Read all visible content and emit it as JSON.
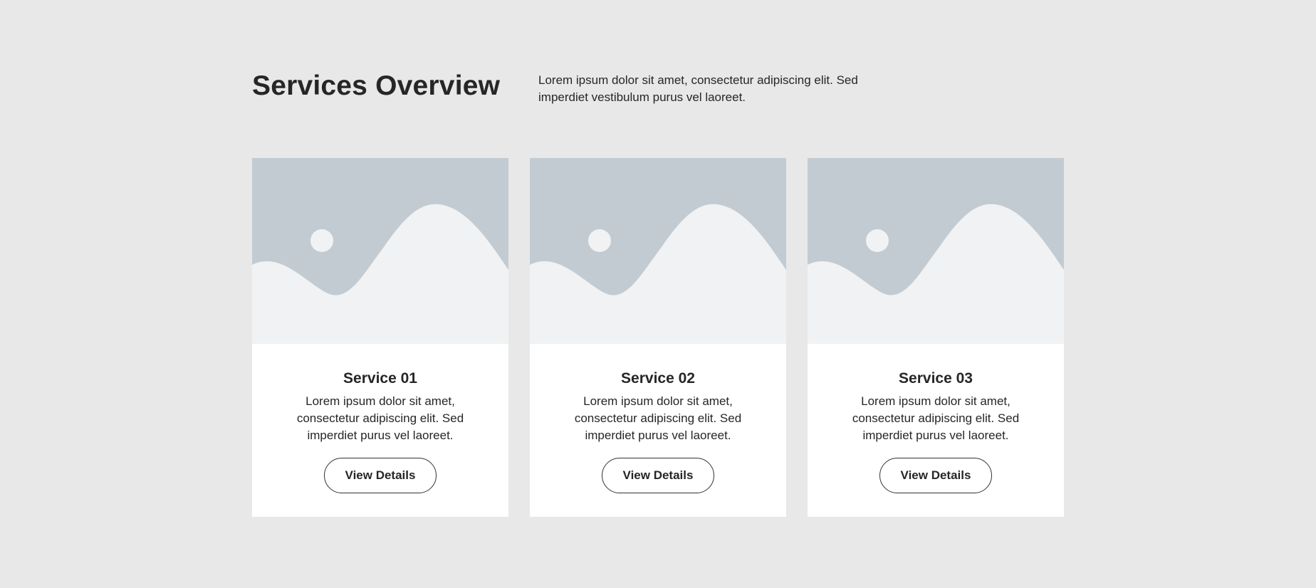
{
  "header": {
    "title": "Services Overview",
    "intro": "Lorem ipsum dolor sit amet, consectetur adipiscing elit. Sed imperdiet vestibulum purus vel laoreet."
  },
  "cards": [
    {
      "title": "Service 01",
      "text": "Lorem ipsum dolor sit amet, consectetur adipiscing elit. Sed imperdiet purus vel laoreet.",
      "button_label": "View Details",
      "image_icon": "image-placeholder-icon"
    },
    {
      "title": "Service 02",
      "text": "Lorem ipsum dolor sit amet, consectetur adipiscing elit. Sed imperdiet purus vel laoreet.",
      "button_label": "View Details",
      "image_icon": "image-placeholder-icon"
    },
    {
      "title": "Service 03",
      "text": "Lorem ipsum dolor sit amet, consectetur adipiscing elit. Sed imperdiet purus vel laoreet.",
      "button_label": "View Details",
      "image_icon": "image-placeholder-icon"
    }
  ],
  "colors": {
    "background": "#e8e8e8",
    "card": "#ffffff",
    "placeholder_sky": "#c3cbd2",
    "placeholder_land": "#f1f2f3",
    "text": "#262626",
    "button_border": "#333333"
  }
}
